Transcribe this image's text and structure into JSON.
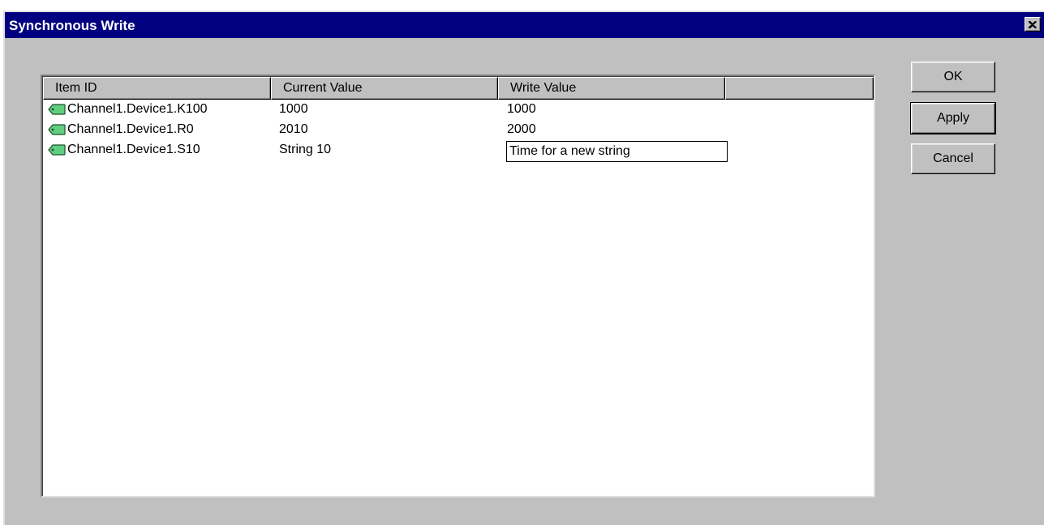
{
  "window": {
    "title": "Synchronous Write",
    "close_icon": "close-icon"
  },
  "table": {
    "columns": [
      "Item ID",
      "Current Value",
      "Write Value",
      ""
    ],
    "rows": [
      {
        "icon": "tag-icon",
        "item_id": "Channel1.Device1.K100",
        "current_value": "1000",
        "write_value": "1000",
        "editing": false
      },
      {
        "icon": "tag-icon",
        "item_id": "Channel1.Device1.R0",
        "current_value": "2010",
        "write_value": "2000",
        "editing": false
      },
      {
        "icon": "tag-icon",
        "item_id": "Channel1.Device1.S10",
        "current_value": "String 10",
        "write_value": "Time for a new string",
        "editing": true
      }
    ]
  },
  "buttons": {
    "ok": "OK",
    "apply": "Apply",
    "cancel": "Cancel"
  },
  "colors": {
    "titlebar": "#000080",
    "face": "#c0c0c0",
    "tag_icon": "#5fcf7f"
  }
}
